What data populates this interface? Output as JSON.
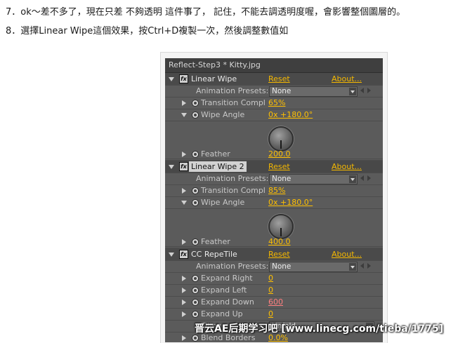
{
  "instructions": {
    "line1": "7．ok～差不多了，現在只差 不夠透明 這件事了， 記住，不能去調透明度喔，會影響整個圖層的。",
    "line2": "8．選擇Linear Wipe這個效果，按Ctrl+D複製一次，然後調整數值如"
  },
  "panel": {
    "title": "Reflect-Step3 * Kitty.jpg",
    "reset_label": "Reset",
    "about_label": "About...",
    "presets_label": "Animation Presets:",
    "presets_value": "None",
    "effects": [
      {
        "name": "Linear Wipe",
        "transition_label": "Transition Compl",
        "transition_value": "65%",
        "angle_label": "Wipe Angle",
        "angle_value": "0x +180.0°",
        "feather_label": "Feather",
        "feather_value": "200.0"
      },
      {
        "name": "Linear Wipe 2",
        "transition_label": "Transition Compl",
        "transition_value": "85%",
        "angle_label": "Wipe Angle",
        "angle_value": "0x +180.0°",
        "feather_label": "Feather",
        "feather_value": "400.0"
      },
      {
        "name": "CC RepeTile",
        "expand_right_label": "Expand Right",
        "expand_right_value": "0",
        "expand_left_label": "Expand Left",
        "expand_left_value": "0",
        "expand_down_label": "Expand Down",
        "expand_down_value": "600",
        "expand_up_label": "Expand Up",
        "expand_up_value": "0",
        "tiling_label": "Tiling",
        "tiling_value": "Unfold",
        "blend_label": "Blend Borders",
        "blend_value": "0.0%"
      }
    ]
  },
  "watermark": "晋云AE后期学习吧 [www.linecg.com/tieba/1775]"
}
